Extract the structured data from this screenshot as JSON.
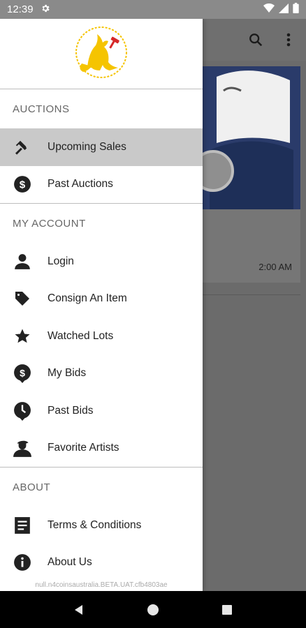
{
  "status_bar": {
    "time": "12:39"
  },
  "background": {
    "card_time": "2:00 AM"
  },
  "drawer": {
    "sections": [
      {
        "title": "AUCTIONS",
        "items": [
          {
            "label": "Upcoming Sales",
            "icon": "gavel-icon",
            "active": true
          },
          {
            "label": "Past Auctions",
            "icon": "dollar-circle-icon"
          }
        ]
      },
      {
        "title": "MY ACCOUNT",
        "items": [
          {
            "label": "Login",
            "icon": "person-icon"
          },
          {
            "label": "Consign An Item",
            "icon": "tag-icon"
          },
          {
            "label": "Watched Lots",
            "icon": "star-icon"
          },
          {
            "label": "My Bids",
            "icon": "dollar-pin-icon"
          },
          {
            "label": "Past Bids",
            "icon": "clock-pin-icon"
          },
          {
            "label": "Favorite Artists",
            "icon": "artist-icon"
          }
        ]
      },
      {
        "title": "ABOUT",
        "items": [
          {
            "label": "Terms & Conditions",
            "icon": "document-icon"
          },
          {
            "label": "About Us",
            "icon": "info-icon"
          }
        ]
      }
    ],
    "build_label": "null.n4coinsaustralia.BETA.UAT.cfb4803ae"
  },
  "colors": {
    "drawer_bg": "#ffffff",
    "active_item": "#c9c9c9",
    "logo_yellow": "#f5c400",
    "logo_red": "#d62828"
  }
}
